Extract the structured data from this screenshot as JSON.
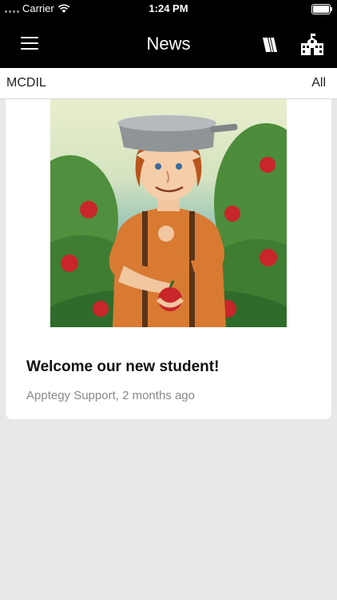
{
  "status_bar": {
    "carrier": "Carrier",
    "time": "1:24 PM"
  },
  "nav": {
    "title": "News",
    "icons": [
      "menu-icon",
      "book-icon",
      "school-icon"
    ]
  },
  "filter": {
    "left_label": "MCDIL",
    "right_label": "All"
  },
  "article": {
    "title": "Welcome our new student!",
    "meta": "Apptegy Support, 2 months ago",
    "image": "illustration of a smiling red-haired man with a cooking pot on his head holding an apple in an apple orchard"
  },
  "colors": {
    "header_bg": "#000000",
    "page_bg": "#e8e8e8",
    "card_bg": "#ffffff",
    "meta_text": "#888888"
  }
}
